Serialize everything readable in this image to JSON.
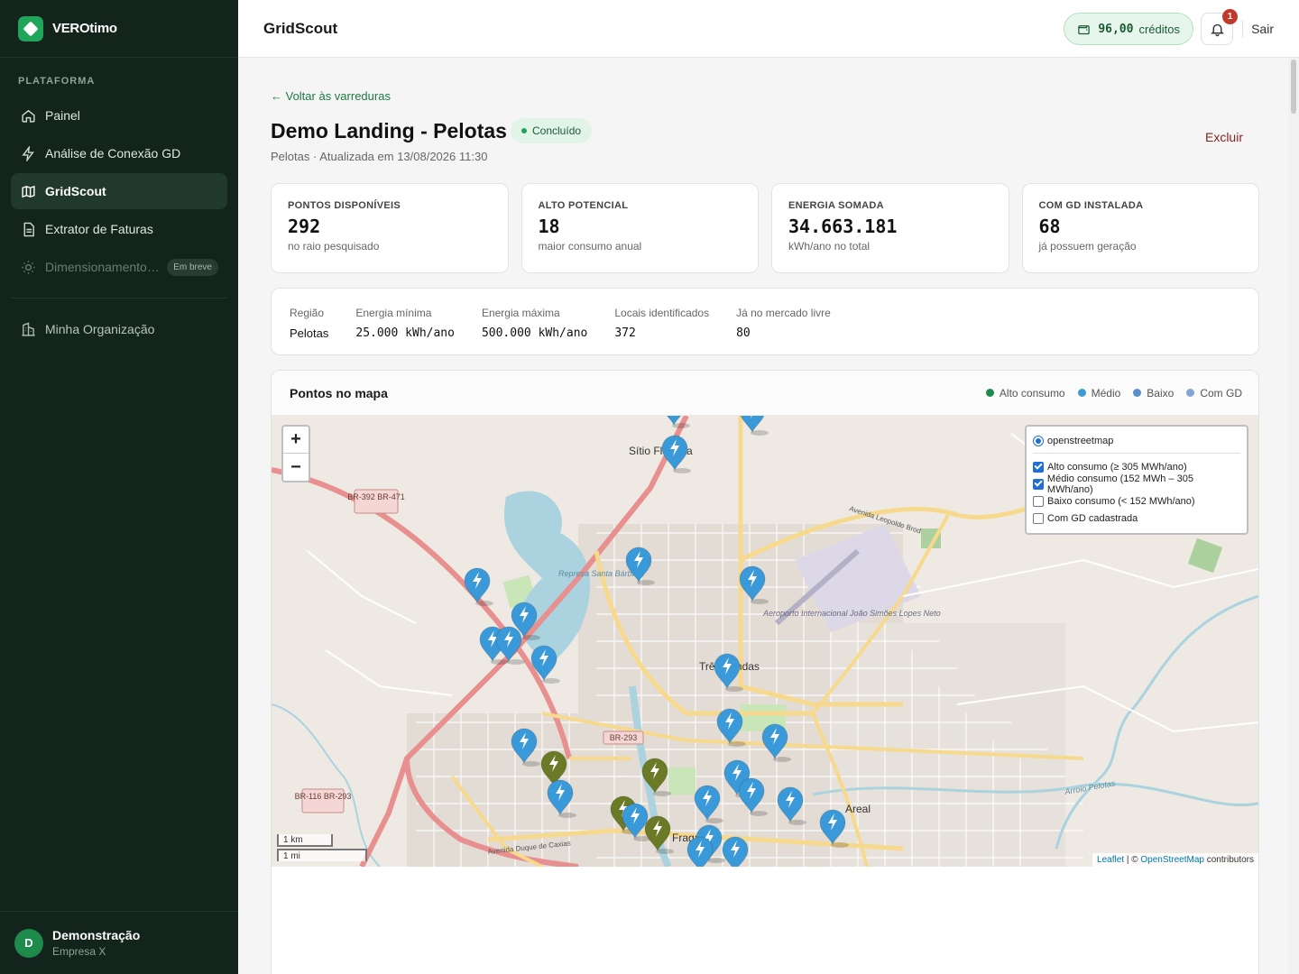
{
  "brand": {
    "name": "VEROtimo"
  },
  "sidebar": {
    "section_label": "PLATAFORMA",
    "items": [
      {
        "label": "Painel",
        "icon": "home-icon"
      },
      {
        "label": "Análise de Conexão GD",
        "icon": "bolt-icon"
      },
      {
        "label": "GridScout",
        "icon": "map-icon"
      },
      {
        "label": "Extrator de Faturas",
        "icon": "file-icon"
      },
      {
        "label": "Dimensionamento…",
        "icon": "sun-icon",
        "badge": "Em breve"
      }
    ],
    "org_item": {
      "label": "Minha Organização",
      "icon": "building-icon"
    },
    "user": {
      "initial": "D",
      "name": "Demonstração",
      "org": "Empresa X"
    }
  },
  "header": {
    "title": "GridScout",
    "credits_amount": "96,00",
    "credits_label": "créditos",
    "notifications": "1",
    "logout": "Sair"
  },
  "page": {
    "back_link": "← Voltar às varreduras",
    "title": "Demo Landing - Pelotas",
    "status": "Concluído",
    "subtitle": "Pelotas · Atualizada em 13/08/2026 11:30",
    "delete": "Excluir"
  },
  "stats": [
    {
      "label": "PONTOS DISPONÍVEIS",
      "value": "292",
      "sub": "no raio pesquisado"
    },
    {
      "label": "ALTO POTENCIAL",
      "value": "18",
      "sub": "maior consumo anual"
    },
    {
      "label": "ENERGIA SOMADA",
      "value": "34.663.181",
      "sub": "kWh/ano no total"
    },
    {
      "label": "COM GD INSTALADA",
      "value": "68",
      "sub": "já possuem geração"
    }
  ],
  "params": [
    {
      "label": "Região",
      "value": "Pelotas"
    },
    {
      "label": "Energia mínima",
      "value": "25.000 kWh/ano"
    },
    {
      "label": "Energia máxima",
      "value": "500.000 kWh/ano"
    },
    {
      "label": "Locais identificados",
      "value": "372"
    },
    {
      "label": "Já no mercado livre",
      "value": "80"
    }
  ],
  "map": {
    "title": "Pontos no mapa",
    "legend": [
      {
        "label": "Alto consumo",
        "color": "#1e8a4c"
      },
      {
        "label": "Médio",
        "color": "#3f9bd6"
      },
      {
        "label": "Baixo",
        "color": "#5b8fc7"
      },
      {
        "label": "Com GD",
        "color": "#7fa6d6"
      }
    ],
    "zoom_in": "+",
    "zoom_out": "−",
    "layers": {
      "base": "openstreetmap",
      "overlays": [
        {
          "label": "Alto consumo (≥ 305 MWh/ano)",
          "checked": true
        },
        {
          "label": "Médio consumo (152 MWh – 305 MWh/ano)",
          "checked": true
        },
        {
          "label": "Baixo consumo (< 152 MWh/ano)",
          "checked": false
        },
        {
          "label": "Com GD cadastrada",
          "checked": false
        }
      ]
    },
    "scale": [
      "1 km",
      "1 mi"
    ],
    "attribution": {
      "leaflet": "Leaflet",
      "sep": " | © ",
      "osm": "OpenStreetMap",
      "suffix": " contributors"
    },
    "place_labels": [
      "Sítio Floresta",
      "Três Vendas",
      "Fragata",
      "Areal",
      "Aeroporto Internacional João Simões Lopes Neto",
      "Represa Santa Bárbara",
      "Arroio Pelotas",
      "Avenida Leopoldo Brod",
      "Avenida Duque de Caxias",
      "BR-392 BR-471",
      "BR-293",
      "BR-116 BR-293"
    ],
    "colors": {
      "medio": "#3a9ad9",
      "gd": "#6b7a26",
      "water": "#aad3df",
      "road_major": "#e88f8f",
      "road_secondary": "#f7d98e"
    },
    "markers": [
      {
        "kind": "medio"
      },
      {
        "kind": "medio"
      },
      {
        "kind": "medio"
      },
      {
        "kind": "medio"
      },
      {
        "kind": "medio"
      },
      {
        "kind": "medio"
      },
      {
        "kind": "medio"
      },
      {
        "kind": "medio"
      },
      {
        "kind": "medio"
      },
      {
        "kind": "medio"
      },
      {
        "kind": "medio"
      },
      {
        "kind": "medio"
      },
      {
        "kind": "medio"
      },
      {
        "kind": "gd"
      },
      {
        "kind": "medio"
      },
      {
        "kind": "gd"
      },
      {
        "kind": "medio"
      },
      {
        "kind": "medio"
      },
      {
        "kind": "medio"
      },
      {
        "kind": "medio"
      },
      {
        "kind": "gd"
      },
      {
        "kind": "medio"
      },
      {
        "kind": "medio"
      },
      {
        "kind": "gd"
      },
      {
        "kind": "medio"
      },
      {
        "kind": "medio"
      },
      {
        "kind": "medio"
      },
      {
        "kind": "medio"
      }
    ]
  }
}
